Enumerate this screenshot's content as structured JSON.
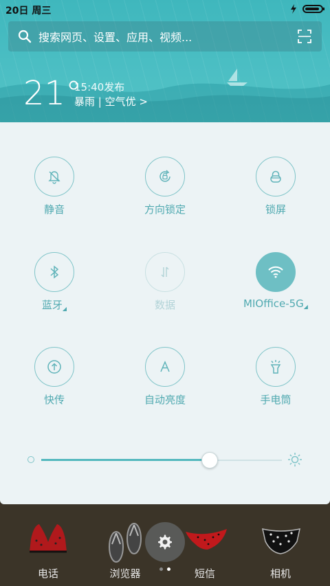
{
  "status_bar": {
    "date": "20日 周三"
  },
  "search": {
    "placeholder": "搜索网页、设置、应用、视频..."
  },
  "weather": {
    "temperature": "21°",
    "published": "15:40发布",
    "condition": "暴雨 | 空气优 >"
  },
  "toggles": [
    {
      "label": "静音",
      "icon": "bell-off-icon",
      "state": "off"
    },
    {
      "label": "方向锁定",
      "icon": "rotation-lock-icon",
      "state": "off"
    },
    {
      "label": "锁屏",
      "icon": "lock-icon",
      "state": "off"
    },
    {
      "label": "蓝牙",
      "icon": "bluetooth-icon",
      "state": "off",
      "expandable": true
    },
    {
      "label": "数据",
      "icon": "data-transfer-icon",
      "state": "disabled"
    },
    {
      "label": "MIOffice-5G",
      "icon": "wifi-icon",
      "state": "on",
      "expandable": true
    },
    {
      "label": "快传",
      "icon": "share-icon",
      "state": "off"
    },
    {
      "label": "自动亮度",
      "icon": "auto-brightness-icon",
      "state": "off"
    },
    {
      "label": "手电筒",
      "icon": "flashlight-icon",
      "state": "off"
    }
  ],
  "brightness": {
    "level": 0.7
  },
  "dock": {
    "apps": [
      {
        "label": "电话"
      },
      {
        "label": "浏览器"
      },
      {
        "label": "短信"
      },
      {
        "label": "相机"
      }
    ],
    "pager": {
      "count": 2,
      "active": 1
    }
  },
  "colors": {
    "accent": "#52b7bd",
    "panel_bg": "#ecf3f5",
    "header": "#4cbfc4"
  }
}
